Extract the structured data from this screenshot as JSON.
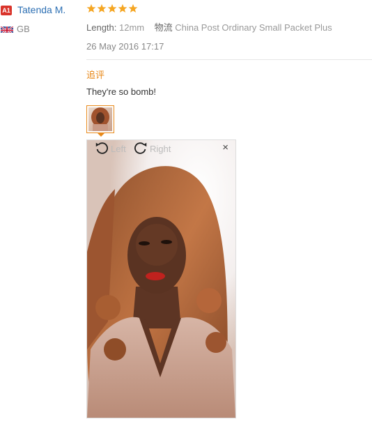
{
  "reviewer": {
    "badge": "A1",
    "name": "Tatenda M.",
    "country": "GB"
  },
  "review": {
    "rating": 5,
    "length_label": "Length:",
    "length_value": "12mm",
    "logistics_label": "物流",
    "logistics_value": "China Post Ordinary Small Packet Plus",
    "date": "26 May 2016 17:17",
    "followup_label": "追评",
    "text": "They're so bomb!"
  },
  "viewer": {
    "rotate_left_label": "Left",
    "rotate_right_label": "Right",
    "close_symbol": "×"
  },
  "colors": {
    "star": "#f5a623",
    "accent": "#e8891a",
    "link": "#2c6fb3",
    "badge": "#d9342b"
  }
}
